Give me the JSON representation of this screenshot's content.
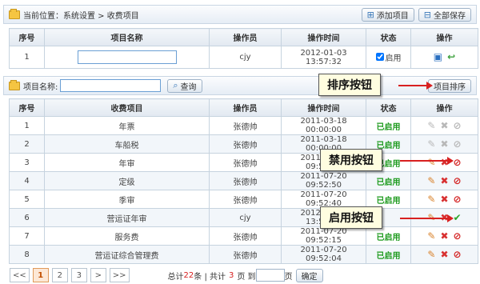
{
  "topbar": {
    "location_label": "当前位置：系统设置 > 收费项目",
    "add_label": "添加项目",
    "save_all_label": "全部保存"
  },
  "edit_table": {
    "headers": [
      "序号",
      "项目名称",
      "操作员",
      "操作时间",
      "状态",
      "操作"
    ],
    "row": {
      "index": "1",
      "name_value": "",
      "operator": "cjy",
      "time": "2012-01-03 13:57:32",
      "status": "启用"
    }
  },
  "search": {
    "label": "项目名称:",
    "value": "",
    "query_label": "查询",
    "sort_label": "项目排序"
  },
  "list_table": {
    "headers": [
      "序号",
      "收费项目",
      "操作员",
      "操作时间",
      "状态",
      "操作"
    ],
    "rows": [
      {
        "index": "1",
        "name": "年票",
        "operator": "张德帅",
        "time": "2011-03-18 00:00:00",
        "status": "已启用",
        "mode": "disabled"
      },
      {
        "index": "2",
        "name": "车船税",
        "operator": "张德帅",
        "time": "2011-03-18 00:00:00",
        "status": "已启用",
        "mode": "disabled"
      },
      {
        "index": "3",
        "name": "年审",
        "operator": "张德帅",
        "time": "2011-07-20 09:52:50",
        "status": "已启用",
        "mode": "ban"
      },
      {
        "index": "4",
        "name": "定级",
        "operator": "张德帅",
        "time": "2011-07-20 09:52:50",
        "status": "已启用",
        "mode": "ban"
      },
      {
        "index": "5",
        "name": "季审",
        "operator": "张德帅",
        "time": "2011-07-20 09:52:40",
        "status": "已启用",
        "mode": "ban"
      },
      {
        "index": "6",
        "name": "营运证年审",
        "operator": "cjy",
        "time": "2012-01-03 13:57:32",
        "status": "",
        "mode": "enable"
      },
      {
        "index": "7",
        "name": "服务费",
        "operator": "张德帅",
        "time": "2011-07-20 09:52:15",
        "status": "已启用",
        "mode": "ban"
      },
      {
        "index": "8",
        "name": "营运证综合管理费",
        "operator": "张德帅",
        "time": "2011-07-20 09:52:04",
        "status": "已启用",
        "mode": "ban"
      }
    ]
  },
  "callouts": {
    "sort": "排序按钮",
    "disable": "禁用按钮",
    "enable": "启用按钮"
  },
  "pager": {
    "first": "<<",
    "pages": [
      "1",
      "2",
      "3"
    ],
    "next": ">",
    "last": ">>",
    "total_prefix": "总计",
    "total_count": "22",
    "total_mid": "条 | 共计",
    "page_count": "3",
    "page_mid": "页 到",
    "page_suffix": "页",
    "confirm_label": "确定"
  },
  "colors": {
    "accent": "#3a78b8",
    "status_green": "#1c9a1c",
    "callout_bg": "#fffde0",
    "arrow_red": "#d82020"
  }
}
